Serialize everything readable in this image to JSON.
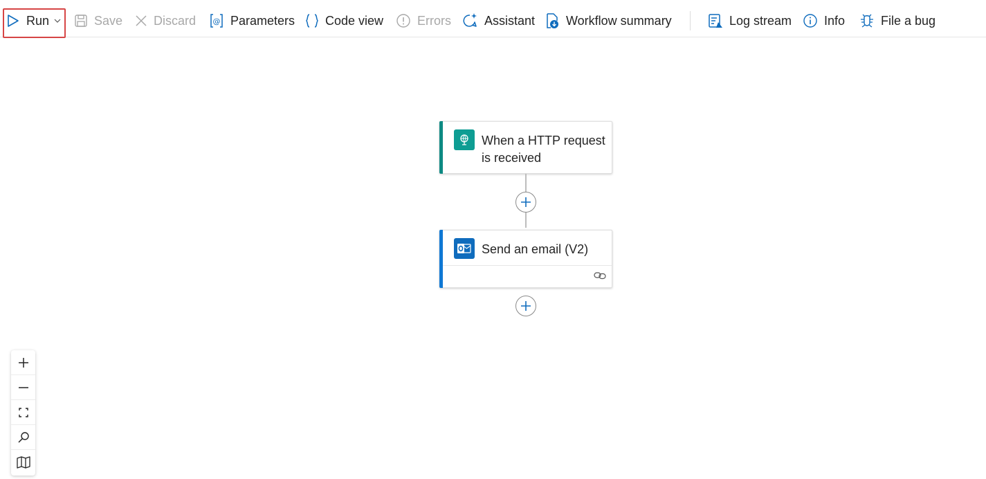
{
  "toolbar": {
    "run_label": "Run",
    "save_label": "Save",
    "discard_label": "Discard",
    "parameters_label": "Parameters",
    "code_view_label": "Code view",
    "errors_label": "Errors",
    "assistant_label": "Assistant",
    "workflow_summary_label": "Workflow summary",
    "log_stream_label": "Log stream",
    "info_label": "Info",
    "file_bug_label": "File a bug"
  },
  "workflow": {
    "trigger": {
      "title_line1": "When a HTTP request",
      "title_line2": "is received",
      "icon": "http-request-icon",
      "accent_color": "#0e8a83"
    },
    "action": {
      "title": "Send an email (V2)",
      "icon": "outlook-icon",
      "accent_color": "#0f78d4",
      "connection_icon": "link-icon"
    }
  },
  "zoom_controls": [
    "zoom-in-icon",
    "zoom-out-icon",
    "fit-view-icon",
    "search-icon",
    "minimap-icon"
  ],
  "colors": {
    "accent": "#0f6cbd",
    "run_highlight": "#d64545",
    "disabled_text": "#a8a8a8"
  }
}
